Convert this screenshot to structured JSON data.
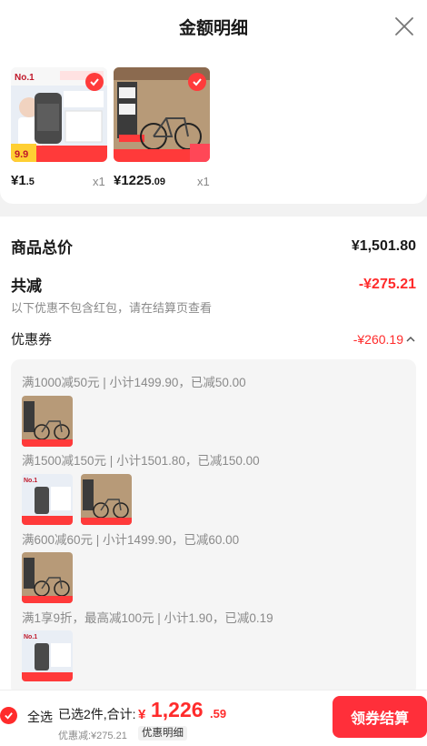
{
  "header": {
    "title": "金额明细",
    "close_icon": "close-icon"
  },
  "products": [
    {
      "price_int": "¥1",
      "price_dec": ".5",
      "qty": "x1",
      "icon": "shampoo-product-image",
      "checked": true
    },
    {
      "price_int": "¥1225",
      "price_dec": ".09",
      "qty": "x1",
      "icon": "bicycle-product-image",
      "checked": true
    }
  ],
  "summary": {
    "total_label": "商品总价",
    "total_value": "¥1,501.80",
    "discount_label": "共减",
    "discount_value": "-¥275.21",
    "discount_note": "以下优惠不包含红包，请在结算页查看",
    "coupon_label": "优惠券",
    "coupon_value": "-¥260.19",
    "coupon_toggle_icon": "chevron-up-icon"
  },
  "coupons": [
    {
      "text": "满1000减50元 | 小计1499.90，已减50.00",
      "items": [
        "bicycle"
      ]
    },
    {
      "text": "满1500减150元 | 小计1501.80，已减150.00",
      "items": [
        "shampoo",
        "bicycle"
      ]
    },
    {
      "text": "满600减60元 | 小计1499.90，已减60.00",
      "items": [
        "bicycle"
      ]
    },
    {
      "text": "满1享9折，最高减100元 | 小计1.90，已减0.19",
      "items": [
        "shampoo"
      ]
    }
  ],
  "footer": {
    "select_all": "全选",
    "selected": "已选2件,合计:",
    "yen": "¥",
    "total_int": "1,226",
    "total_dec": ".59",
    "savings": "优惠减:¥275.21",
    "detail_label": "优惠明细",
    "checkout_button": "领券结算"
  },
  "colors": {
    "accent": "#ff2b2b",
    "button": "#ff2f3a",
    "panel": "#f5f5f5"
  }
}
